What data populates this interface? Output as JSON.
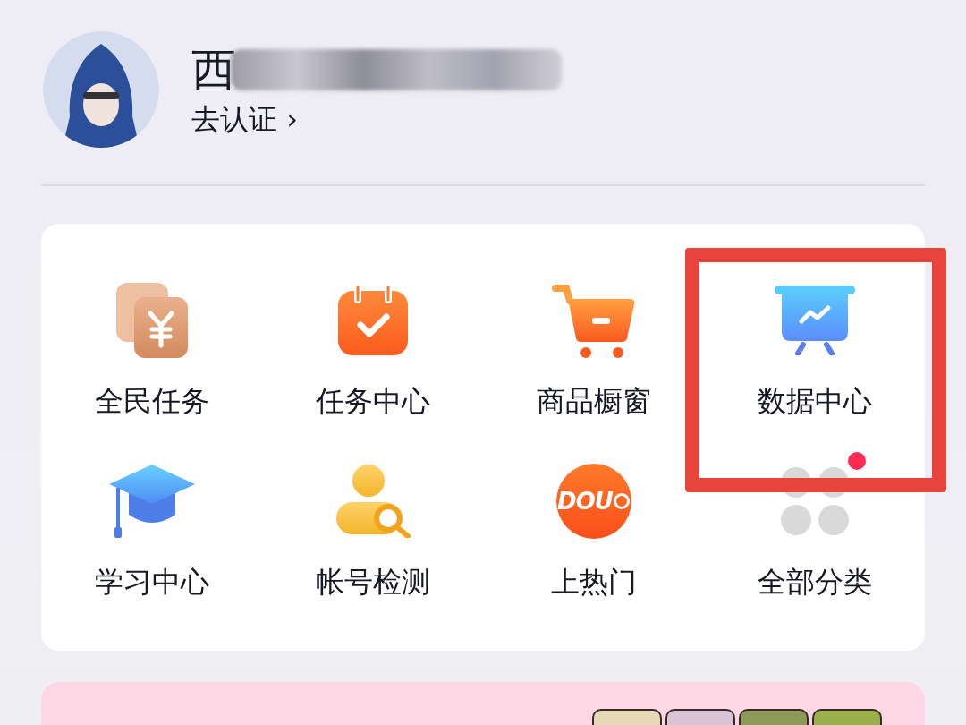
{
  "profile": {
    "name": "西",
    "name_redacted": true,
    "verify_link": "去认证 ›"
  },
  "services": [
    {
      "kind": "coins",
      "label": "全民任务",
      "highlighted": false,
      "dot": false
    },
    {
      "kind": "calendar",
      "label": "任务中心",
      "highlighted": false,
      "dot": false
    },
    {
      "kind": "cart",
      "label": "商品橱窗",
      "highlighted": false,
      "dot": false
    },
    {
      "kind": "board",
      "label": "数据中心",
      "highlighted": true,
      "dot": false
    },
    {
      "kind": "cap",
      "label": "学习中心",
      "highlighted": false,
      "dot": false
    },
    {
      "kind": "user-search",
      "label": "帐号检测",
      "highlighted": false,
      "dot": false
    },
    {
      "kind": "dou",
      "label": "上热门",
      "logo_text": "DOU",
      "highlighted": false,
      "dot": false
    },
    {
      "kind": "grid",
      "label": "全部分类",
      "highlighted": false,
      "dot": true
    }
  ]
}
